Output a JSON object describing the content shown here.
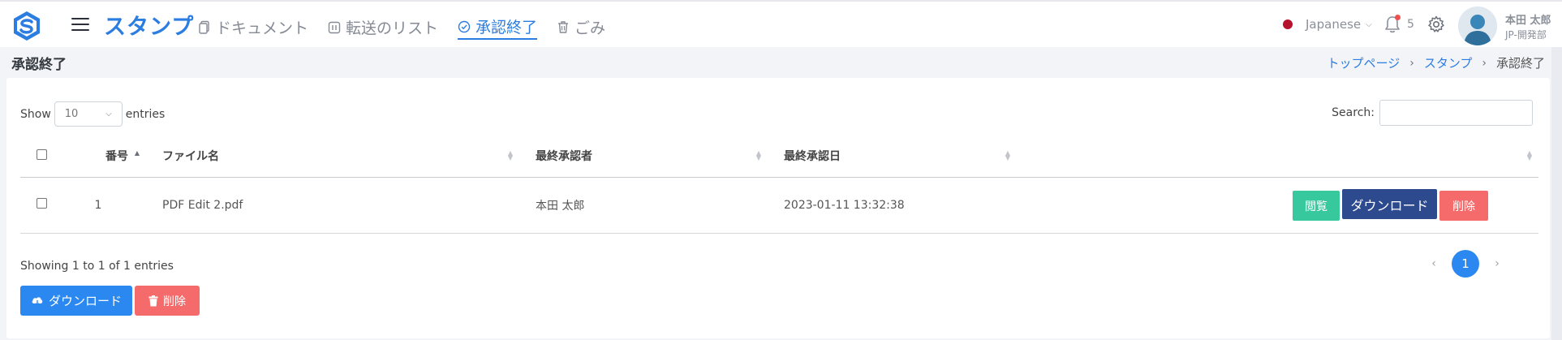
{
  "header": {
    "app_title": "スタンプ",
    "nav": [
      {
        "label": "ドキュメント",
        "icon": "document-icon"
      },
      {
        "label": "転送のリスト",
        "icon": "list-icon"
      },
      {
        "label": "承認終了",
        "icon": "check-circle-icon",
        "active": true
      },
      {
        "label": "ごみ",
        "icon": "trash-icon"
      }
    ],
    "language": "Japanese",
    "notification_count": "5",
    "user_name": "本田 太郎",
    "user_dept": "JP-開発部"
  },
  "page": {
    "title": "承認終了",
    "breadcrumb": [
      "トップページ",
      "スタンプ",
      "承認終了"
    ]
  },
  "table_controls": {
    "show_label": "Show",
    "entries_label": "entries",
    "page_length": "10",
    "search_label": "Search:",
    "search_value": ""
  },
  "table": {
    "columns": [
      "番号",
      "ファイル名",
      "最終承認者",
      "最終承認日"
    ],
    "rows": [
      {
        "no": "1",
        "file_name": "PDF Edit 2.pdf",
        "approver": "本田 太郎",
        "approved_at": "2023-01-11 13:32:38",
        "view_label": "閲覧",
        "download_label": "ダウンロード",
        "delete_label": "削除"
      }
    ]
  },
  "footer": {
    "info": "Showing 1 to 1 of 1 entries",
    "current_page": "1",
    "prev_symbol": "‹",
    "next_symbol": "›",
    "bulk_download_label": "ダウンロード",
    "bulk_delete_label": "削除"
  },
  "colors": {
    "accent": "#2b7de1",
    "view_button": "#38c89d",
    "download_button": "#2e4a8f",
    "delete_button": "#f56b6b",
    "pagination_active": "#2b88f0"
  }
}
